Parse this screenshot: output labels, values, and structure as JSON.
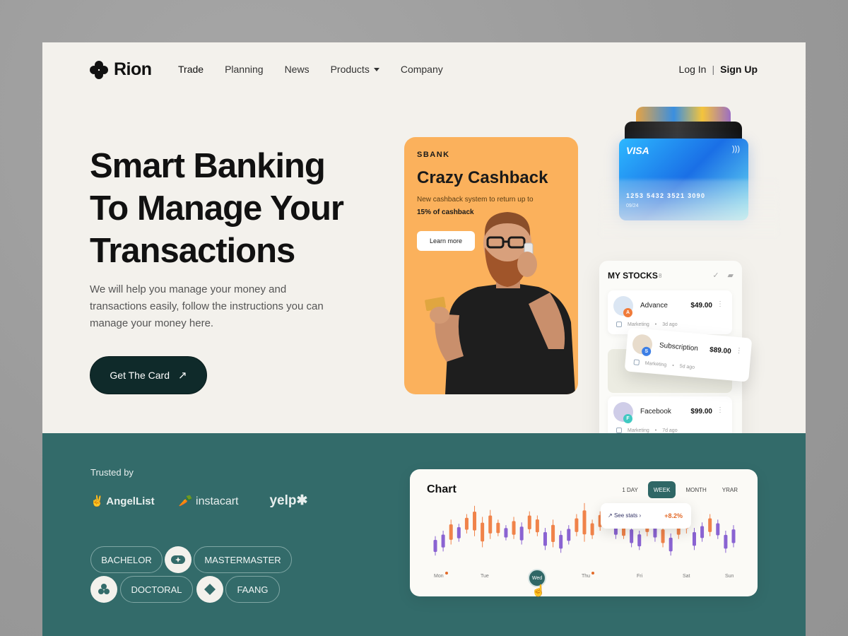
{
  "nav": {
    "logo": "Rion",
    "links": [
      "Trade",
      "Planning",
      "News",
      "Products",
      "Company"
    ],
    "login": "Log In",
    "separator": "|",
    "signup": "Sign Up"
  },
  "hero": {
    "title_line1": "Smart Banking",
    "title_line2": "To Manage Your",
    "title_line3": "Transactions",
    "description": "We will help you manage your money and transactions easily,  follow the instructions you can manage your money here.",
    "cta": "Get The Card",
    "cta_icon": "arrow-up-right-icon"
  },
  "promo": {
    "brand": "SBANK",
    "headline": "Crazy Cashback",
    "subtitle": "New cashback system to return up to",
    "highlight": "15% of cashback",
    "button": "Learn more"
  },
  "card": {
    "network": "VISA",
    "number": "1253  5432  3521  3090",
    "expiry": "09/24"
  },
  "stocks": {
    "title": "MY STOCKS",
    "count": "8",
    "items": [
      {
        "name": "Advance",
        "price": "$49.00",
        "badge": "A",
        "category": "Marketing",
        "time": "3d ago",
        "badge_color": "#f07b3a",
        "avatar_color": "#dbe6f3"
      },
      {
        "name": "Subscription",
        "price": "$89.00",
        "badge": "S",
        "category": "Marketing",
        "time": "5d ago",
        "badge_color": "#3d7fe6",
        "avatar_color": "#e8dccc"
      },
      {
        "name": "Facebook",
        "price": "$99.00",
        "badge": "F",
        "category": "Marketing",
        "time": "7d ago",
        "badge_color": "#41c9c2",
        "avatar_color": "#cfcde8"
      }
    ]
  },
  "trusted": {
    "label": "Trusted by",
    "logos": [
      "AngelList",
      "instacart",
      "yelp"
    ]
  },
  "pills": [
    "BACHELOR",
    "MASTERMASTER",
    "DOCTORAL",
    "FAANG"
  ],
  "chart": {
    "title": "Chart",
    "tabs": [
      "1 DAY",
      "WEEK",
      "MONTH",
      "YRAR"
    ],
    "active_tab": "WEEK",
    "tooltip_label": "See stats",
    "tooltip_value": "+8.2%",
    "days": [
      "Mon",
      "Tue",
      "Wed",
      "Thu",
      "Fri",
      "Sat",
      "Sun"
    ],
    "selected_day": "Wed",
    "colors": {
      "up": "#f0834a",
      "down": "#8a63d2"
    }
  },
  "chart_data": {
    "type": "bar",
    "categories": [
      "Mon",
      "Tue",
      "Wed",
      "Thu",
      "Fri",
      "Sat",
      "Sun"
    ],
    "candles": [
      {
        "h": 58,
        "l": 44,
        "c": "down"
      },
      {
        "h": 62,
        "l": 47,
        "c": "down"
      },
      {
        "h": 70,
        "l": 52,
        "c": "up"
      },
      {
        "h": 67,
        "l": 54,
        "c": "down"
      },
      {
        "h": 74,
        "l": 60,
        "c": "up"
      },
      {
        "h": 80,
        "l": 58,
        "c": "up"
      },
      {
        "h": 72,
        "l": 50,
        "c": "up"
      },
      {
        "h": 77,
        "l": 56,
        "c": "up"
      },
      {
        "h": 70,
        "l": 58,
        "c": "up"
      },
      {
        "h": 66,
        "l": 55,
        "c": "down"
      },
      {
        "h": 72,
        "l": 56,
        "c": "up"
      },
      {
        "h": 68,
        "l": 52,
        "c": "down"
      },
      {
        "h": 76,
        "l": 60,
        "c": "up"
      },
      {
        "h": 73,
        "l": 58,
        "c": "up"
      },
      {
        "h": 64,
        "l": 48,
        "c": "down"
      },
      {
        "h": 70,
        "l": 50,
        "c": "up"
      },
      {
        "h": 62,
        "l": 46,
        "c": "down"
      },
      {
        "h": 66,
        "l": 52,
        "c": "down"
      },
      {
        "h": 74,
        "l": 58,
        "c": "up"
      },
      {
        "h": 82,
        "l": 54,
        "c": "up"
      },
      {
        "h": 70,
        "l": 56,
        "c": "up"
      },
      {
        "h": 76,
        "l": 62,
        "c": "up"
      },
      {
        "h": 80,
        "l": 64,
        "c": "up"
      },
      {
        "h": 72,
        "l": 56,
        "c": "down"
      },
      {
        "h": 68,
        "l": 56,
        "c": "up"
      },
      {
        "h": 66,
        "l": 50,
        "c": "down"
      },
      {
        "h": 62,
        "l": 48,
        "c": "down"
      },
      {
        "h": 74,
        "l": 58,
        "c": "up"
      },
      {
        "h": 70,
        "l": 54,
        "c": "down"
      },
      {
        "h": 66,
        "l": 50,
        "c": "up"
      },
      {
        "h": 60,
        "l": 44,
        "c": "down"
      },
      {
        "h": 72,
        "l": 56,
        "c": "up"
      },
      {
        "h": 78,
        "l": 60,
        "c": "up"
      },
      {
        "h": 64,
        "l": 48,
        "c": "down"
      },
      {
        "h": 68,
        "l": 54,
        "c": "down"
      },
      {
        "h": 74,
        "l": 58,
        "c": "up"
      },
      {
        "h": 70,
        "l": 56,
        "c": "down"
      },
      {
        "h": 62,
        "l": 46,
        "c": "down"
      },
      {
        "h": 66,
        "l": 50,
        "c": "down"
      }
    ]
  }
}
